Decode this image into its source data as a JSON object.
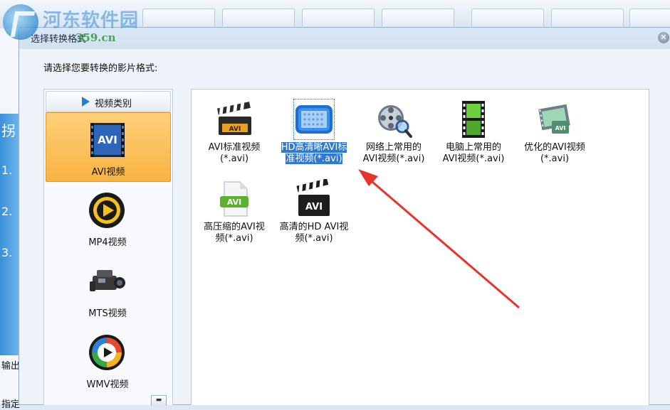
{
  "watermark": {
    "title": "河东软件园",
    "url": "359.cn"
  },
  "background_app": {
    "left_texts": [
      "拐",
      "1.",
      "2.",
      "3.",
      "输出",
      "指定"
    ]
  },
  "dialog": {
    "title": "选择转换格式",
    "close_symbol": "✕",
    "prompt": "请选择您要转换的影片格式:",
    "category_header": "视频类别",
    "categories": [
      {
        "label": "AVI视频",
        "icon": "avi-icon",
        "selected": true
      },
      {
        "label": "MP4视频",
        "icon": "mp4-play-icon",
        "selected": false
      },
      {
        "label": "MTS视频",
        "icon": "camcorder-icon",
        "selected": false
      },
      {
        "label": "WMV视频",
        "icon": "wmv-play-icon",
        "selected": false
      }
    ],
    "scroll_symbol": "▬",
    "formats": [
      {
        "line1": "AVI标准视频",
        "line2": "(*.avi)",
        "icon": "clapperboard-avi-icon",
        "selected": false
      },
      {
        "line1": "HD高清晰AVI标",
        "line2": "准视频(*.avi)",
        "icon": "hd-film-icon",
        "selected": true
      },
      {
        "line1": "网络上常用的",
        "line2": "AVI视频(*.avi)",
        "icon": "film-reel-magnifier-icon",
        "selected": false
      },
      {
        "line1": "电脑上常用的",
        "line2": "AVI视频(*.avi)",
        "icon": "film-strip-icon",
        "selected": false
      },
      {
        "line1": "优化的AVI视频",
        "line2": "(*.avi)",
        "icon": "optimized-film-icon",
        "selected": false
      },
      {
        "line1": "高压缩的AVI视",
        "line2": "频(*.avi)",
        "icon": "compressed-avi-file-icon",
        "selected": false
      },
      {
        "line1": "高清的HD AVI视",
        "line2": "频(*.avi)",
        "icon": "hd-clapperboard-avi-icon",
        "selected": false
      }
    ]
  },
  "colors": {
    "selected_category": "#f8b342",
    "selected_format": "#2f78d3",
    "annotation_arrow": "#e8332b"
  }
}
